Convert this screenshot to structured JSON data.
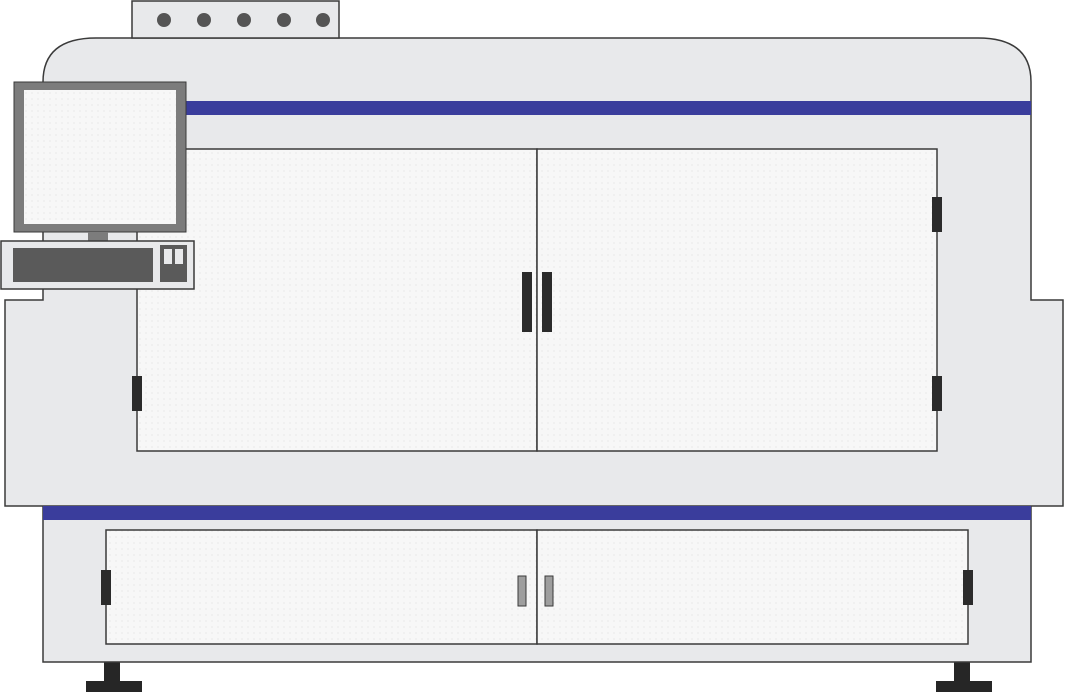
{
  "machine": {
    "colors": {
      "body_fill": "#e8e9eb",
      "outline": "#3a3a3a",
      "accent_stripe": "#3a3d9c",
      "door_panel": "#f7f7f7",
      "door_dots": "#d2d2d2",
      "hinge": "#2b2b2b",
      "monitor_frame": "#7c7c7c",
      "monitor_screen": "#f7f7f7",
      "keyboard": "#5a5a5a",
      "signal_light": "#555555",
      "feet": "#262626",
      "lower_handle": "#9e9e9e"
    },
    "signal_lights_count": 5,
    "upper_doors_count": 2,
    "lower_doors_count": 2
  }
}
